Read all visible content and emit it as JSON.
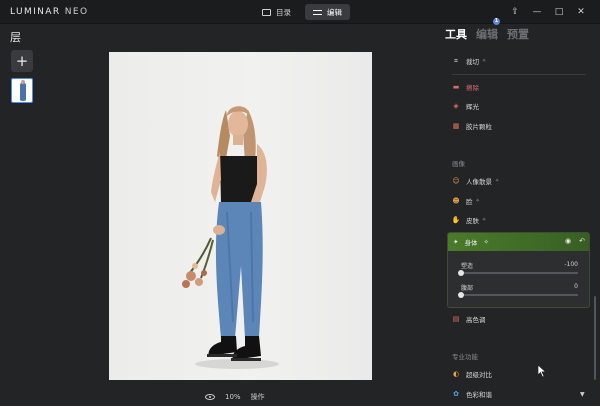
{
  "app": {
    "logo_main": "LUMINAR",
    "logo_suffix": "NEO"
  },
  "topnav": {
    "catalog_label": "目录",
    "edit_label": "编辑"
  },
  "window_controls": {
    "share": "⇪",
    "minimize": "—",
    "maximize": "□",
    "close": "✕"
  },
  "layers": {
    "title": "层",
    "add_label": "+"
  },
  "canvas": {
    "zoom": "10%",
    "actions_label": "操作"
  },
  "right_panel": {
    "tabs": [
      {
        "label": "工具",
        "active": true
      },
      {
        "label": "编辑",
        "active": false,
        "badge": "1"
      },
      {
        "label": "预置",
        "active": false
      }
    ],
    "tools_top": [
      {
        "icon": "crop-icon",
        "glyph": "⌗",
        "label": "裁切",
        "star": "✧"
      },
      {
        "icon": "erase-icon",
        "glyph": "▬",
        "label": "擦除"
      },
      {
        "icon": "glow-icon",
        "glyph": "◈",
        "label": "辉光"
      },
      {
        "icon": "film-grain-icon",
        "glyph": "▦",
        "label": "胶片颗粒"
      }
    ],
    "portrait_section": "画像",
    "portrait_tools": [
      {
        "icon": "portrait-bokeh-icon",
        "glyph": "☺",
        "label": "人像散景",
        "star": "✧"
      },
      {
        "icon": "face-icon",
        "glyph": "☻",
        "label": "脸",
        "star": "✧"
      },
      {
        "icon": "skin-icon",
        "glyph": "✋",
        "label": "皮肤",
        "star": "✧"
      }
    ],
    "body_tool": {
      "label": "身体",
      "star": "✧",
      "sliders": [
        {
          "name": "塑造",
          "value": "-100",
          "fraction": 0.0
        },
        {
          "name": "腹部",
          "value": "0",
          "fraction": 0.0
        }
      ]
    },
    "high_key_tool": {
      "icon": "high-key-icon",
      "glyph": "▤",
      "label": "高色调"
    },
    "pro_section": "专业功能",
    "pro_tools": [
      {
        "icon": "super-contrast-icon",
        "glyph": "◐",
        "label": "超级对比"
      },
      {
        "icon": "color-harmony-icon",
        "glyph": "✿",
        "label": "色彩和谐"
      }
    ],
    "colors": {
      "accent_green": "#4a7a2a",
      "accent_blue": "#5a86e0",
      "background": "#232426"
    }
  }
}
